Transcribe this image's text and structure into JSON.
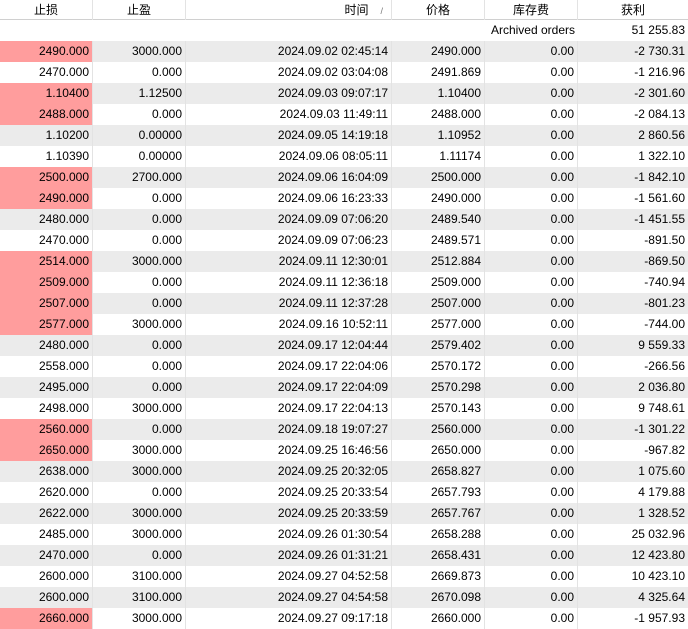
{
  "columns": [
    "止损",
    "止盈",
    "时间",
    "价格",
    "库存费",
    "获利"
  ],
  "sort_indicator": "/",
  "summary": {
    "label": "Archived orders",
    "total": "51 255.83"
  },
  "rows": [
    {
      "sl": "2490.000",
      "tp": "3000.000",
      "time": "2024.09.02 02:45:14",
      "price": "2490.000",
      "swap": "0.00",
      "profit": "-2 730.31",
      "hit": true
    },
    {
      "sl": "2470.000",
      "tp": "0.000",
      "time": "2024.09.02 03:04:08",
      "price": "2491.869",
      "swap": "0.00",
      "profit": "-1 216.96",
      "hit": false
    },
    {
      "sl": "1.10400",
      "tp": "1.12500",
      "time": "2024.09.03 09:07:17",
      "price": "1.10400",
      "swap": "0.00",
      "profit": "-2 301.60",
      "hit": true
    },
    {
      "sl": "2488.000",
      "tp": "0.000",
      "time": "2024.09.03 11:49:11",
      "price": "2488.000",
      "swap": "0.00",
      "profit": "-2 084.13",
      "hit": true
    },
    {
      "sl": "1.10200",
      "tp": "0.00000",
      "time": "2024.09.05 14:19:18",
      "price": "1.10952",
      "swap": "0.00",
      "profit": "2 860.56",
      "hit": false
    },
    {
      "sl": "1.10390",
      "tp": "0.00000",
      "time": "2024.09.06 08:05:11",
      "price": "1.11174",
      "swap": "0.00",
      "profit": "1 322.10",
      "hit": false
    },
    {
      "sl": "2500.000",
      "tp": "2700.000",
      "time": "2024.09.06 16:04:09",
      "price": "2500.000",
      "swap": "0.00",
      "profit": "-1 842.10",
      "hit": true
    },
    {
      "sl": "2490.000",
      "tp": "0.000",
      "time": "2024.09.06 16:23:33",
      "price": "2490.000",
      "swap": "0.00",
      "profit": "-1 561.60",
      "hit": true
    },
    {
      "sl": "2480.000",
      "tp": "0.000",
      "time": "2024.09.09 07:06:20",
      "price": "2489.540",
      "swap": "0.00",
      "profit": "-1 451.55",
      "hit": false
    },
    {
      "sl": "2470.000",
      "tp": "0.000",
      "time": "2024.09.09 07:06:23",
      "price": "2489.571",
      "swap": "0.00",
      "profit": "-891.50",
      "hit": false
    },
    {
      "sl": "2514.000",
      "tp": "3000.000",
      "time": "2024.09.11 12:30:01",
      "price": "2512.884",
      "swap": "0.00",
      "profit": "-869.50",
      "hit": true
    },
    {
      "sl": "2509.000",
      "tp": "0.000",
      "time": "2024.09.11 12:36:18",
      "price": "2509.000",
      "swap": "0.00",
      "profit": "-740.94",
      "hit": true
    },
    {
      "sl": "2507.000",
      "tp": "0.000",
      "time": "2024.09.11 12:37:28",
      "price": "2507.000",
      "swap": "0.00",
      "profit": "-801.23",
      "hit": true
    },
    {
      "sl": "2577.000",
      "tp": "3000.000",
      "time": "2024.09.16 10:52:11",
      "price": "2577.000",
      "swap": "0.00",
      "profit": "-744.00",
      "hit": true
    },
    {
      "sl": "2480.000",
      "tp": "0.000",
      "time": "2024.09.17 12:04:44",
      "price": "2579.402",
      "swap": "0.00",
      "profit": "9 559.33",
      "hit": false
    },
    {
      "sl": "2558.000",
      "tp": "0.000",
      "time": "2024.09.17 22:04:06",
      "price": "2570.172",
      "swap": "0.00",
      "profit": "-266.56",
      "hit": false
    },
    {
      "sl": "2495.000",
      "tp": "0.000",
      "time": "2024.09.17 22:04:09",
      "price": "2570.298",
      "swap": "0.00",
      "profit": "2 036.80",
      "hit": false
    },
    {
      "sl": "2498.000",
      "tp": "3000.000",
      "time": "2024.09.17 22:04:13",
      "price": "2570.143",
      "swap": "0.00",
      "profit": "9 748.61",
      "hit": false
    },
    {
      "sl": "2560.000",
      "tp": "0.000",
      "time": "2024.09.18 19:07:27",
      "price": "2560.000",
      "swap": "0.00",
      "profit": "-1 301.22",
      "hit": true
    },
    {
      "sl": "2650.000",
      "tp": "3000.000",
      "time": "2024.09.25 16:46:56",
      "price": "2650.000",
      "swap": "0.00",
      "profit": "-967.82",
      "hit": true
    },
    {
      "sl": "2638.000",
      "tp": "3000.000",
      "time": "2024.09.25 20:32:05",
      "price": "2658.827",
      "swap": "0.00",
      "profit": "1 075.60",
      "hit": false
    },
    {
      "sl": "2620.000",
      "tp": "0.000",
      "time": "2024.09.25 20:33:54",
      "price": "2657.793",
      "swap": "0.00",
      "profit": "4 179.88",
      "hit": false
    },
    {
      "sl": "2622.000",
      "tp": "3000.000",
      "time": "2024.09.25 20:33:59",
      "price": "2657.767",
      "swap": "0.00",
      "profit": "1 328.52",
      "hit": false
    },
    {
      "sl": "2485.000",
      "tp": "3000.000",
      "time": "2024.09.26 01:30:54",
      "price": "2658.288",
      "swap": "0.00",
      "profit": "25 032.96",
      "hit": false
    },
    {
      "sl": "2470.000",
      "tp": "0.000",
      "time": "2024.09.26 01:31:21",
      "price": "2658.431",
      "swap": "0.00",
      "profit": "12 423.80",
      "hit": false
    },
    {
      "sl": "2600.000",
      "tp": "3100.000",
      "time": "2024.09.27 04:52:58",
      "price": "2669.873",
      "swap": "0.00",
      "profit": "10 423.10",
      "hit": false
    },
    {
      "sl": "2600.000",
      "tp": "3100.000",
      "time": "2024.09.27 04:54:58",
      "price": "2670.098",
      "swap": "0.00",
      "profit": "4 325.64",
      "hit": false
    },
    {
      "sl": "2660.000",
      "tp": "3000.000",
      "time": "2024.09.27 09:17:18",
      "price": "2660.000",
      "swap": "0.00",
      "profit": "-1 957.93",
      "hit": true
    }
  ]
}
